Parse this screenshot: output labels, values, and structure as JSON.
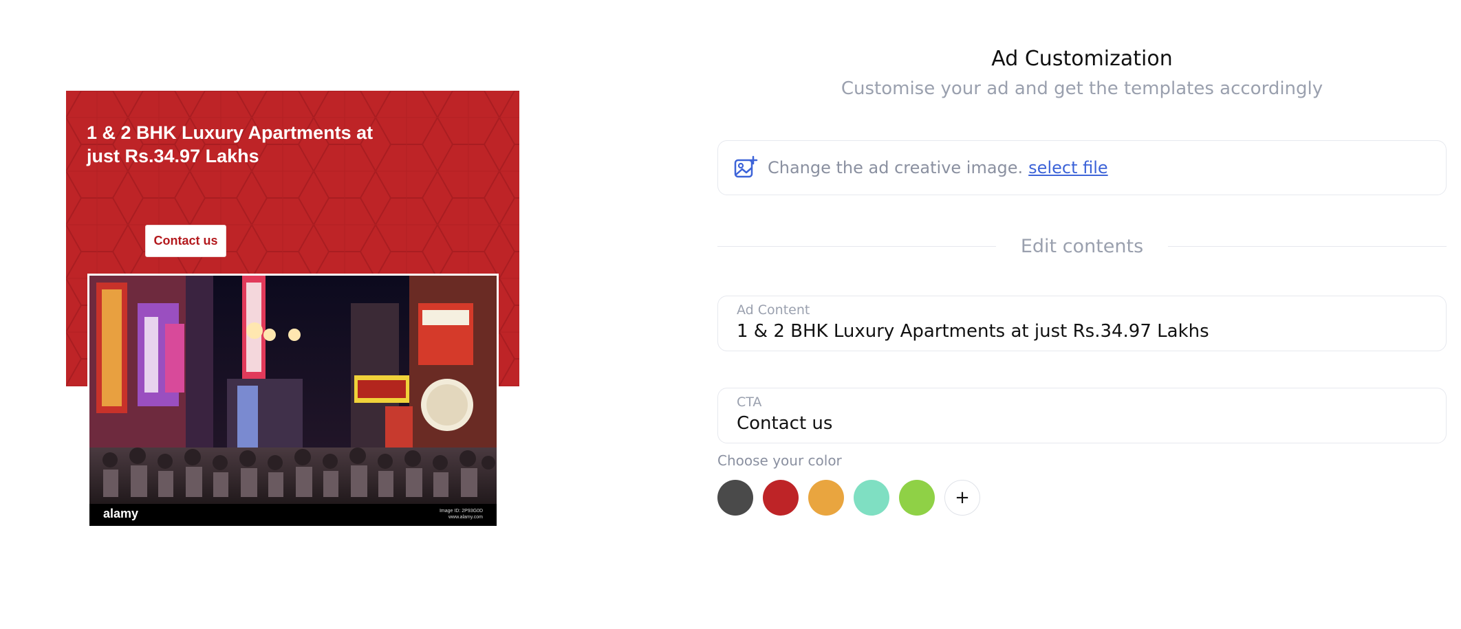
{
  "ad_preview": {
    "headline": "1 & 2 BHK Luxury Apartments at just Rs.34.97 Lakhs",
    "cta_label": "Contact us",
    "photo_brand": "alamy",
    "photo_credit_line1": "Image ID: 2P93G0D",
    "photo_credit_line2": "www.alamy.com",
    "background_color": "#be2427"
  },
  "panel": {
    "title": "Ad Customization",
    "subtitle": "Customise your ad and get the templates accordingly",
    "upload": {
      "icon": "image-add-icon",
      "text": "Change the ad creative image.",
      "link_label": "select file"
    },
    "section_label": "Edit contents",
    "ad_content": {
      "label": "Ad Content",
      "value": "1 & 2 BHK Luxury Apartments at just Rs.34.97 Lakhs"
    },
    "cta": {
      "label": "CTA",
      "value": "Contact us"
    },
    "color_picker": {
      "label": "Choose your color",
      "colors": [
        "#4a4a4a",
        "#be2427",
        "#e9a53f",
        "#7fdfc2",
        "#8fd146"
      ],
      "add_label": "+"
    }
  }
}
